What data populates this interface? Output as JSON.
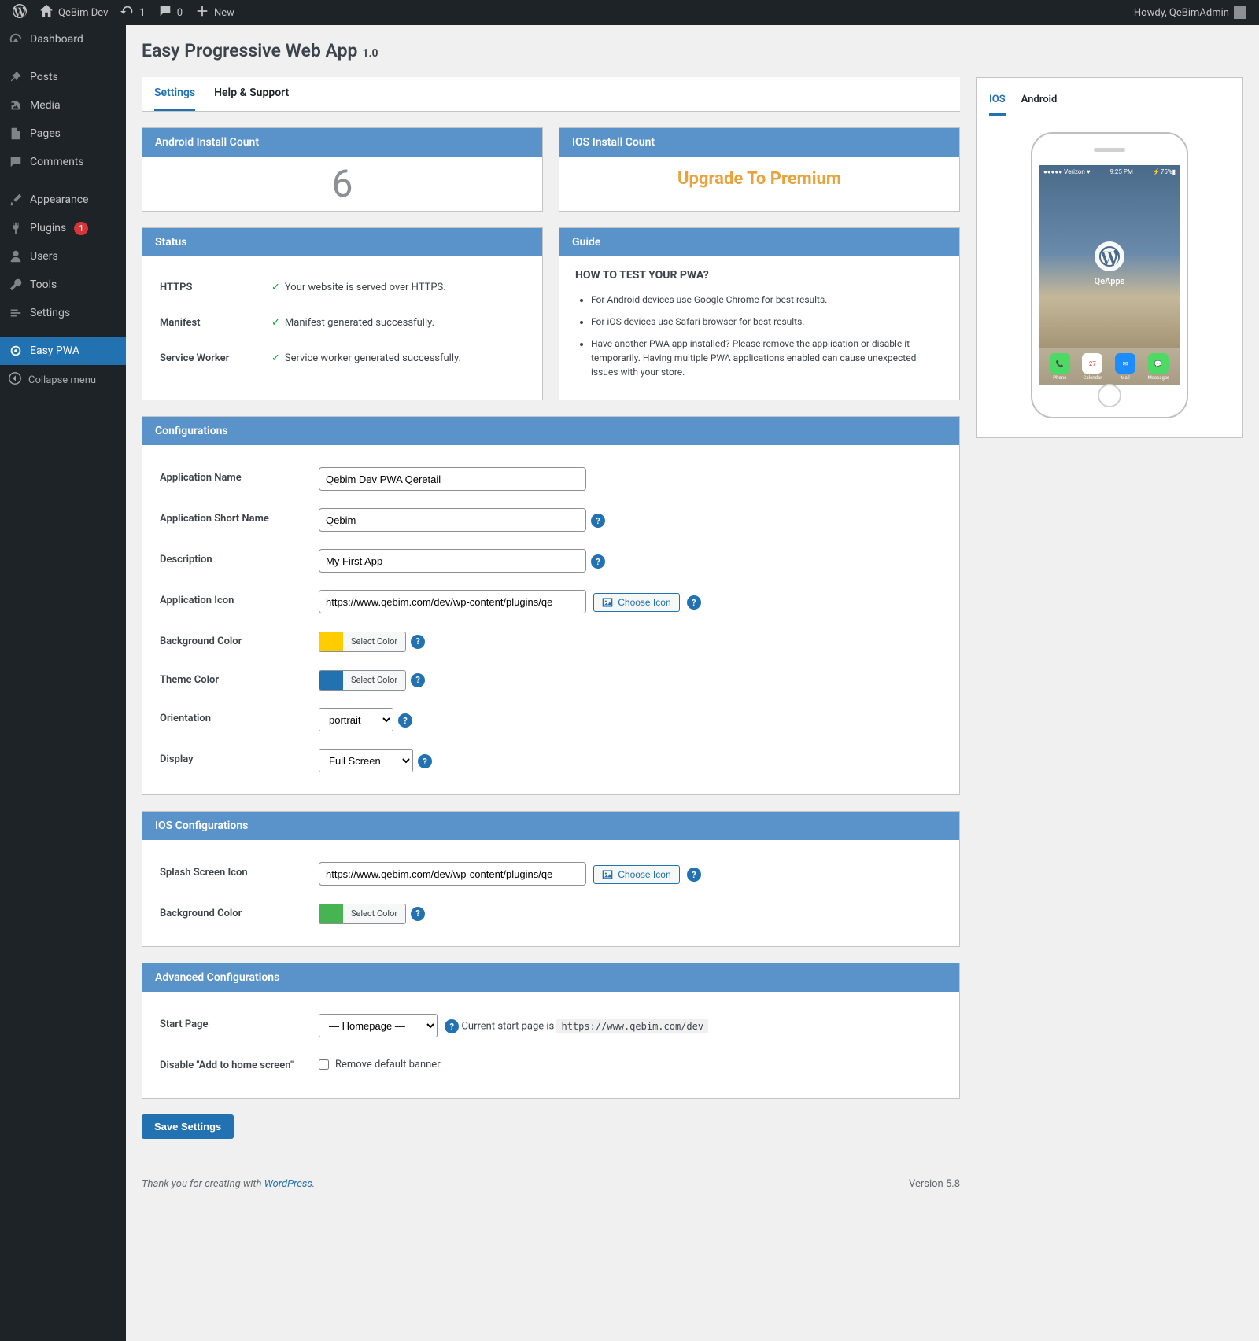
{
  "adminbar": {
    "site_name": "QeBim Dev",
    "updates": "1",
    "comments": "0",
    "new": "New",
    "howdy": "Howdy, QeBimAdmin"
  },
  "sidebar": {
    "items": [
      {
        "label": "Dashboard"
      },
      {
        "label": "Posts"
      },
      {
        "label": "Media"
      },
      {
        "label": "Pages"
      },
      {
        "label": "Comments"
      },
      {
        "label": "Appearance"
      },
      {
        "label": "Plugins",
        "badge": "1"
      },
      {
        "label": "Users"
      },
      {
        "label": "Tools"
      },
      {
        "label": "Settings"
      },
      {
        "label": "Easy PWA"
      }
    ],
    "collapse": "Collapse menu"
  },
  "page": {
    "title": "Easy Progressive Web App",
    "version": "1.0"
  },
  "tabs": {
    "settings": "Settings",
    "help": "Help & Support"
  },
  "cards": {
    "android_install": {
      "title": "Android Install Count",
      "value": "6"
    },
    "ios_install": {
      "title": "IOS Install Count",
      "value": "Upgrade To Premium"
    },
    "status": {
      "title": "Status",
      "rows": [
        {
          "label": "HTTPS",
          "text": "Your website is served over HTTPS."
        },
        {
          "label": "Manifest",
          "text": "Manifest generated successfully."
        },
        {
          "label": "Service Worker",
          "text": "Service worker generated successfully."
        }
      ]
    },
    "guide": {
      "title": "Guide",
      "heading": "HOW TO TEST YOUR PWA?",
      "items": [
        "For Android devices use Google Chrome for best results.",
        "For iOS devices use Safari browser for best results.",
        "Have another PWA app installed? Please remove the application or disable it temporarily. Having multiple PWA applications enabled can cause unexpected issues with your store."
      ]
    }
  },
  "config": {
    "title": "Configurations",
    "fields": {
      "app_name": {
        "label": "Application Name",
        "value": "Qebim Dev PWA Qeretail"
      },
      "short_name": {
        "label": "Application Short Name",
        "value": "Qebim"
      },
      "description": {
        "label": "Description",
        "value": "My First App"
      },
      "icon": {
        "label": "Application Icon",
        "value": "https://www.qebim.com/dev/wp-content/plugins/qe",
        "button": "Choose Icon"
      },
      "bg_color": {
        "label": "Background Color",
        "value": "#ffcc00",
        "button": "Select Color"
      },
      "theme_color": {
        "label": "Theme Color",
        "value": "#2271b1",
        "button": "Select Color"
      },
      "orientation": {
        "label": "Orientation",
        "value": "portrait"
      },
      "display": {
        "label": "Display",
        "value": "Full Screen"
      }
    }
  },
  "ios_config": {
    "title": "IOS Configurations",
    "fields": {
      "splash": {
        "label": "Splash Screen Icon",
        "value": "https://www.qebim.com/dev/wp-content/plugins/qe",
        "button": "Choose Icon"
      },
      "bg_color": {
        "label": "Background Color",
        "value": "#46b450",
        "button": "Select Color"
      }
    }
  },
  "advanced": {
    "title": "Advanced Configurations",
    "fields": {
      "start_page": {
        "label": "Start Page",
        "value": "— Homepage —",
        "note_prefix": "Current start page is",
        "note_url": "https://www.qebim.com/dev"
      },
      "disable_banner": {
        "label": "Disable \"Add to home screen\"",
        "checkbox_label": "Remove default banner"
      }
    }
  },
  "save_button": "Save Settings",
  "preview": {
    "tabs": {
      "ios": "IOS",
      "android": "Android"
    },
    "app_name": "QeApps",
    "status_left": "●●●●● Verizon ♥",
    "status_time": "9:25 PM"
  },
  "footer": {
    "thanks_prefix": "Thank you for creating with ",
    "wp": "WordPress",
    "version": "Version 5.8"
  }
}
